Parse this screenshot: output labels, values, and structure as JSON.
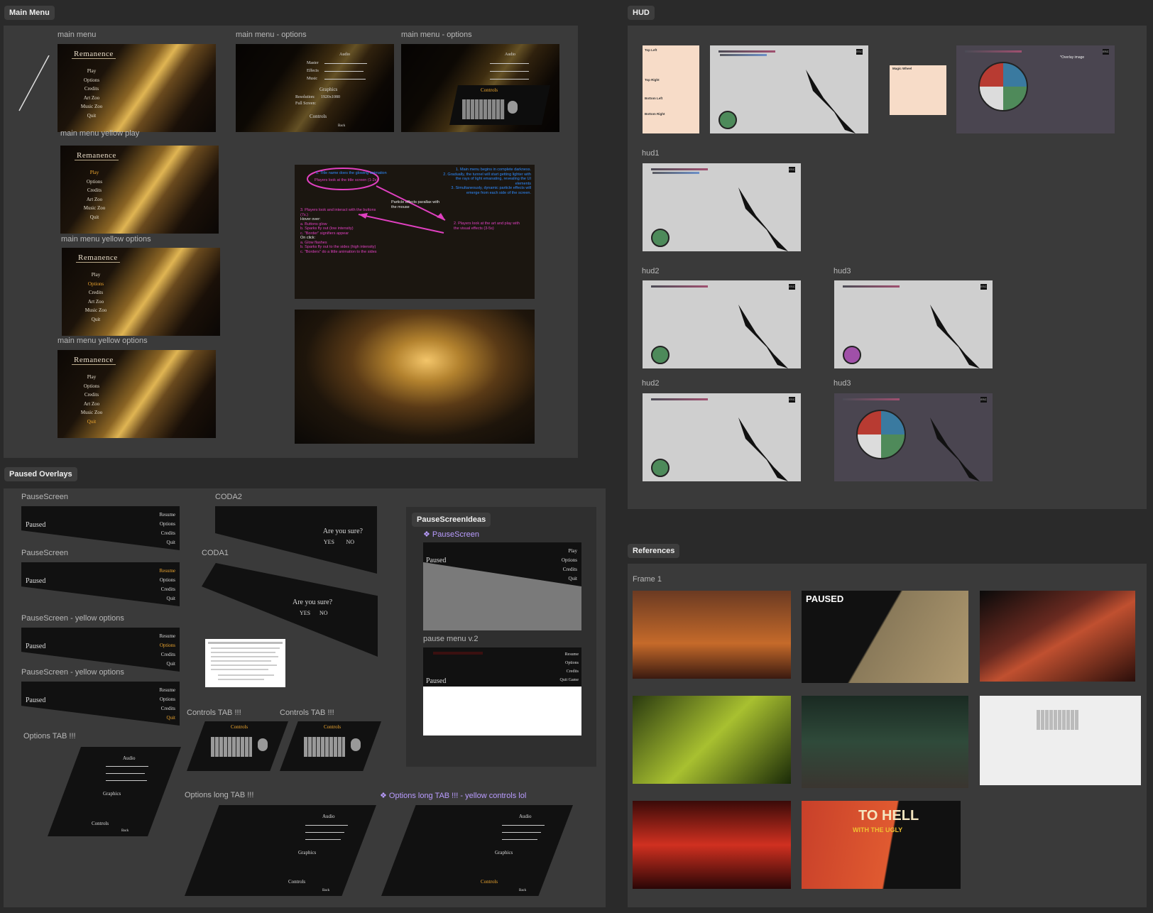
{
  "sections": {
    "main_menu": "Main Menu",
    "hud": "HUD",
    "paused_overlays": "Paused Overlays",
    "references": "References"
  },
  "main_menu": {
    "frame_labels": {
      "main_menu": "main menu",
      "options_1": "main menu - options",
      "options_2": "main menu - options",
      "yellow_play": "main menu yellow play",
      "yellow_options": "main menu yellow options",
      "yellow_options_2": "main menu yellow options"
    },
    "game_title": "Remanence",
    "menu_items": [
      "Play",
      "Options",
      "Credits",
      "Art Zoo",
      "Music Zoo",
      "Quit"
    ],
    "options_items": {
      "audio": "Audio",
      "master": "Master",
      "effects": "Effects",
      "music": "Music",
      "graphics": "Graphics",
      "resolution": "Resolution:",
      "resolution_value": "1920x1080",
      "full_screen": "Full Screen:",
      "controls": "Controls",
      "back": "Back"
    },
    "notes": {
      "n1": "1. Title name does the glowing animation",
      "n2": "Players look at the title screen (1-2s)",
      "n3": "1. Main menu begins in complete darkness.",
      "n4": "2. Gradually, the tunnel will start getting lighter with the rays of light emanating, revealing the UI elements",
      "n5": "3. Simultaneously, dynamic particle effects will emerge from each side of the screen.",
      "n6": "Particle effects parallax with the mouse",
      "n7": "3. Players look and interact with the buttons (7s.)",
      "n8": "Hover over:",
      "n9": "a. Buttons glow",
      "n10": "b. Sparks fly out (low intensity)",
      "n11": "c. \"Border\" signifiers appear",
      "n12": "On click:",
      "n13": "a. Glow flashes",
      "n14": "b. Sparks fly out to the sides (high intensity)",
      "n15": "c. \"Borders\" do a little animation to the sides",
      "n16": "2. Players look at the art and play with the visual effects (3-5s)"
    }
  },
  "hud": {
    "frame_labels": {
      "hud1": "hud1",
      "hud2a": "hud2",
      "hud3a": "hud3",
      "hud2b": "hud2",
      "hud3b": "hud3"
    },
    "legend_top_left": "Top Left",
    "legend_top_right": "Top Right",
    "legend_bottom_left": "Bottom Left",
    "legend_bottom_right": "Bottom Right",
    "magic_wheel": "Magic Wheel",
    "overlay_image": "*Overlay image",
    "esc": "ESC"
  },
  "paused": {
    "frame_labels": {
      "pause1": "PauseScreen",
      "pause2": "PauseScreen",
      "pause3": "PauseScreen - yellow options",
      "pause4": "PauseScreen - yellow options",
      "coda2": "CODA2",
      "coda1": "CODA1",
      "options_tab": "Options TAB !!!",
      "controls_tab1": "Controls TAB !!!",
      "controls_tab2": "Controls TAB !!!",
      "options_long": "Options long TAB !!!",
      "options_long_yellow": "❖ Options long TAB !!! - yellow controls lol",
      "ideas": "PauseScreenIdeas",
      "ideas_pause": "❖ PauseScreen",
      "pause_v2": "pause menu v.2"
    },
    "paused_title": "Paused",
    "pause_items": [
      "Resume",
      "Options",
      "Credits",
      "Quit"
    ],
    "ideas_items": [
      "Play",
      "Options",
      "Credits",
      "Quit"
    ],
    "v2_items": [
      "Resume",
      "Options",
      "Credits",
      "Quit Game"
    ],
    "are_you_sure": "Are you sure?",
    "yes": "YES",
    "no": "NO",
    "controls": "Controls",
    "back": "Back"
  },
  "references": {
    "frame_label": "Frame 1",
    "paused": "PAUSED",
    "to_hell": "TO HELL",
    "with_the_ugly": "WITH THE UGLY"
  },
  "colors": {
    "canvas": "#2a2a2a",
    "section_bg": "#3a3a3a",
    "accent_orange": "#f0a830",
    "note_blue": "#2e8bff",
    "note_pink": "#e040c0",
    "purple_label": "#b99cff"
  }
}
